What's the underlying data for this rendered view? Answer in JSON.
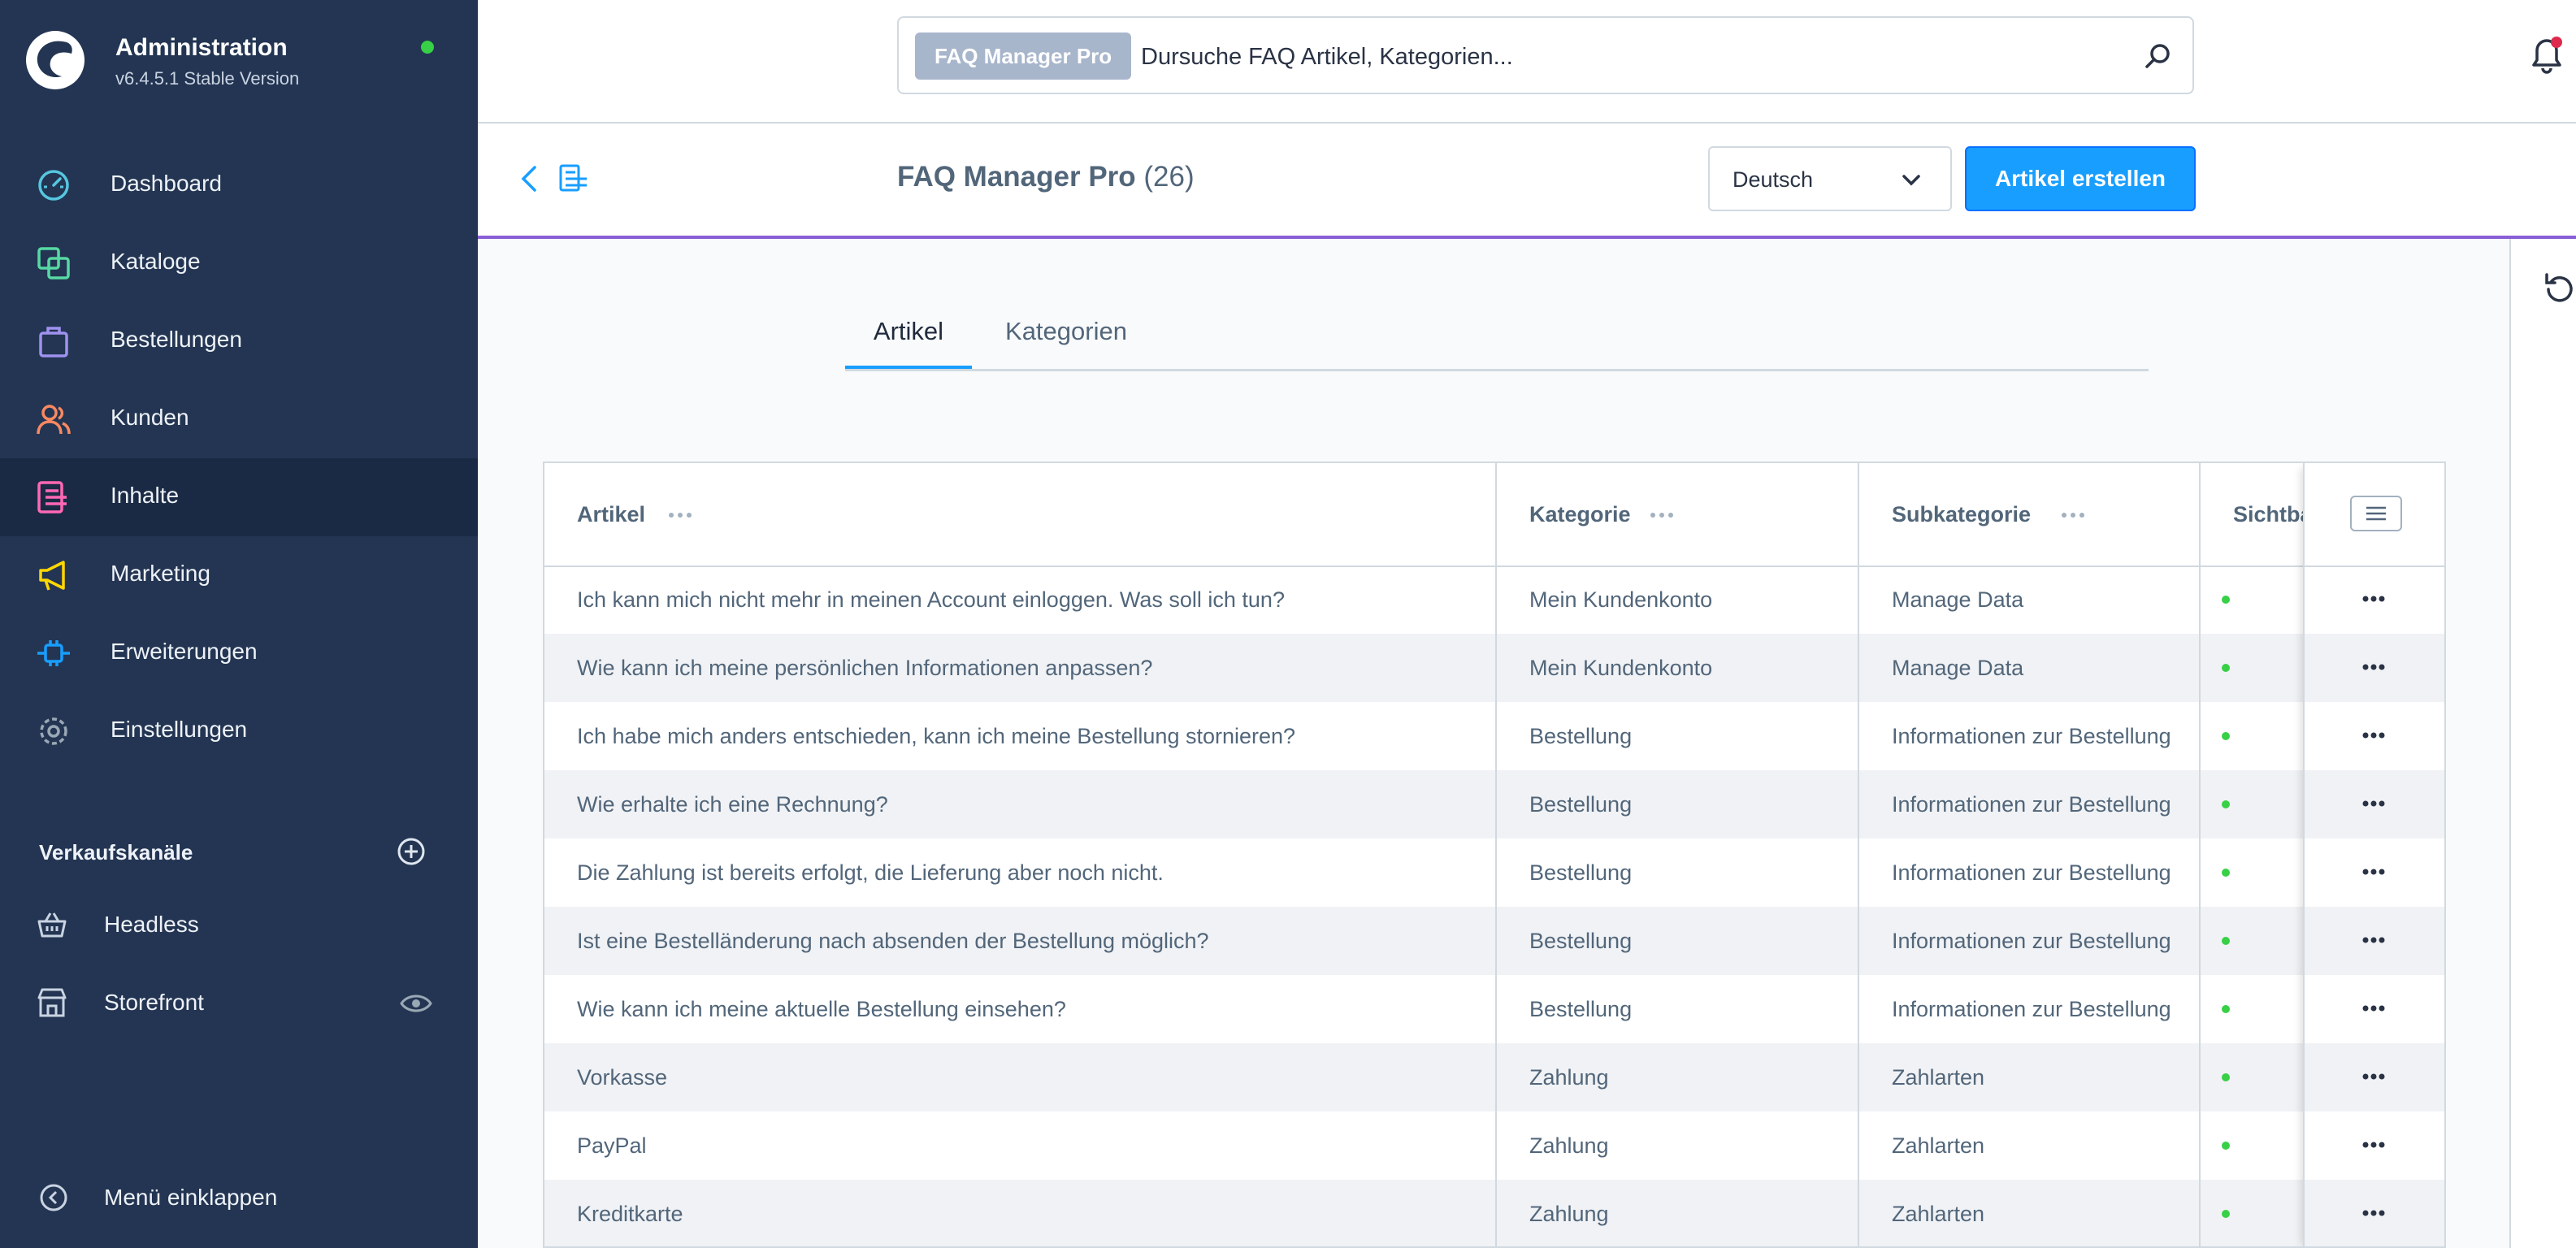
{
  "brand": {
    "title": "Administration",
    "version": "v6.4.5.1 Stable Version"
  },
  "colors": {
    "sidebar": "#233552",
    "accent": "#189eff",
    "status_green": "#37d046",
    "smartbar_border": "#8a5fd6"
  },
  "sidebar": {
    "items": [
      {
        "label": "Dashboard",
        "icon": "dashboard-icon"
      },
      {
        "label": "Kataloge",
        "icon": "catalog-icon"
      },
      {
        "label": "Bestellungen",
        "icon": "shopping-bag-icon"
      },
      {
        "label": "Kunden",
        "icon": "customers-icon"
      },
      {
        "label": "Inhalte",
        "icon": "content-icon"
      },
      {
        "label": "Marketing",
        "icon": "megaphone-icon"
      },
      {
        "label": "Erweiterungen",
        "icon": "plug-icon"
      },
      {
        "label": "Einstellungen",
        "icon": "gear-icon"
      }
    ],
    "active_item": "Inhalte",
    "sales_channels_title": "Verkaufskanäle",
    "channels": [
      {
        "label": "Headless",
        "icon": "basket-icon"
      },
      {
        "label": "Storefront",
        "icon": "storefront-icon"
      }
    ],
    "collapse_label": "Menü einklappen"
  },
  "search": {
    "chip": "FAQ Manager Pro",
    "placeholder": "Dursuche FAQ Artikel, Kategorien..."
  },
  "smartbar": {
    "title": "FAQ Manager Pro",
    "count": "(26)",
    "language": "Deutsch",
    "create_button": "Artikel erstellen"
  },
  "tabs": [
    {
      "label": "Artikel",
      "active": true
    },
    {
      "label": "Kategorien",
      "active": false
    }
  ],
  "table": {
    "columns": [
      "Artikel",
      "Kategorie",
      "Subkategorie",
      "Sichtbar"
    ],
    "rows": [
      {
        "artikel": "Ich kann mich nicht mehr in meinen Account einloggen. Was soll ich tun?",
        "kategorie": "Mein Kundenkonto",
        "subkategorie": "Manage Data",
        "visible": true
      },
      {
        "artikel": "Wie kann ich meine persönlichen Informationen anpassen?",
        "kategorie": "Mein Kundenkonto",
        "subkategorie": "Manage Data",
        "visible": true
      },
      {
        "artikel": "Ich habe mich anders entschieden, kann ich meine Bestellung stornieren?",
        "kategorie": "Bestellung",
        "subkategorie": "Informationen zur Bestellung",
        "visible": true
      },
      {
        "artikel": "Wie erhalte ich eine Rechnung?",
        "kategorie": "Bestellung",
        "subkategorie": "Informationen zur Bestellung",
        "visible": true
      },
      {
        "artikel": "Die Zahlung ist bereits erfolgt, die Lieferung aber noch nicht.",
        "kategorie": "Bestellung",
        "subkategorie": "Informationen zur Bestellung",
        "visible": true
      },
      {
        "artikel": "Ist eine Bestelländerung nach absenden der Bestellung möglich?",
        "kategorie": "Bestellung",
        "subkategorie": "Informationen zur Bestellung",
        "visible": true
      },
      {
        "artikel": "Wie kann ich meine aktuelle Bestellung einsehen?",
        "kategorie": "Bestellung",
        "subkategorie": "Informationen zur Bestellung",
        "visible": true
      },
      {
        "artikel": "Vorkasse",
        "kategorie": "Zahlung",
        "subkategorie": "Zahlarten",
        "visible": true
      },
      {
        "artikel": "PayPal",
        "kategorie": "Zahlung",
        "subkategorie": "Zahlarten",
        "visible": true
      },
      {
        "artikel": "Kreditkarte",
        "kategorie": "Zahlung",
        "subkategorie": "Zahlarten",
        "visible": true
      }
    ]
  }
}
